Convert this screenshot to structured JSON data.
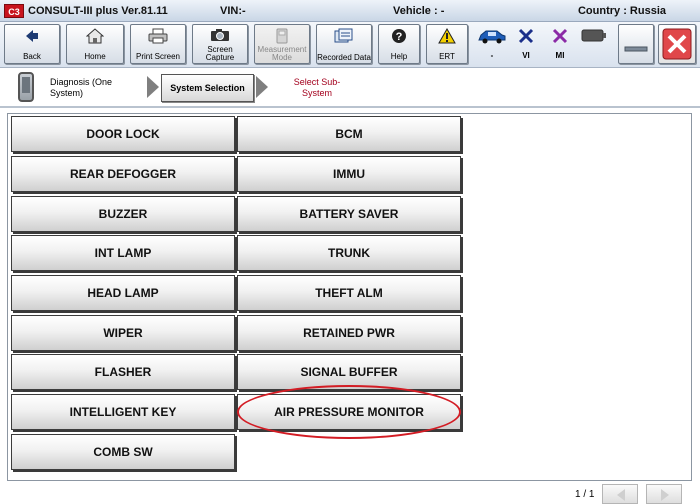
{
  "title_bar": {
    "app_icon_text": "C3",
    "app_title": "CONSULT-III plus   Ver.81.11",
    "vin": "VIN:-",
    "vehicle": "Vehicle : -",
    "country": "Country : Russia"
  },
  "toolbar": {
    "back_label": "Back",
    "home_label": "Home",
    "print_label": "Print Screen",
    "capture_label": "Screen Capture",
    "measurement_label": "Measurement Mode",
    "recorded_label": "Recorded Data",
    "help_label": "Help",
    "ert_label": "ERT",
    "vehicle_status_label": "-",
    "vi_label": "VI",
    "mi_label": "MI"
  },
  "breadcrumb": {
    "step1": "Diagnosis (One System)",
    "step2": "System Selection",
    "step3": "Select Sub-System"
  },
  "systems": {
    "left": [
      "DOOR LOCK",
      "REAR DEFOGGER",
      "BUZZER",
      "INT LAMP",
      "HEAD LAMP",
      "WIPER",
      "FLASHER",
      "INTELLIGENT KEY",
      "COMB SW"
    ],
    "right": [
      "BCM",
      "IMMU",
      "BATTERY SAVER",
      "TRUNK",
      "THEFT ALM",
      "RETAINED PWR",
      "SIGNAL BUFFER",
      "AIR PRESSURE MONITOR"
    ]
  },
  "footer": {
    "page_indicator": "1 / 1"
  },
  "colors": {
    "highlight": "#d31c24",
    "breadcrumb_next": "#a3001d",
    "app_icon": "#c8141e"
  }
}
